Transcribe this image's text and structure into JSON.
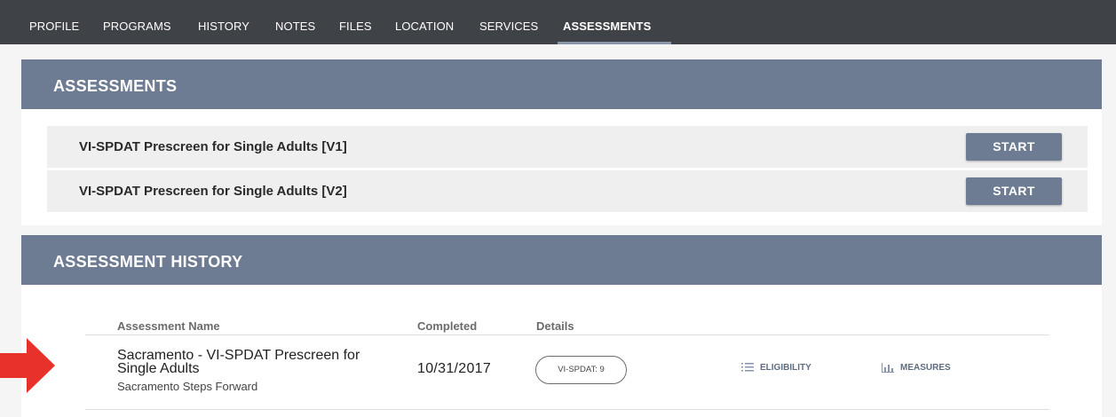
{
  "nav": {
    "tabs": [
      {
        "label": "PROFILE"
      },
      {
        "label": "PROGRAMS"
      },
      {
        "label": "HISTORY"
      },
      {
        "label": "NOTES"
      },
      {
        "label": "FILES"
      },
      {
        "label": "LOCATION"
      },
      {
        "label": "SERVICES"
      },
      {
        "label": "ASSESSMENTS",
        "active": true
      }
    ]
  },
  "assessments": {
    "title": "ASSESSMENTS",
    "items": [
      {
        "name": "VI-SPDAT Prescreen for Single Adults [V1]",
        "button": "START"
      },
      {
        "name": "VI-SPDAT Prescreen for Single Adults [V2]",
        "button": "START"
      }
    ]
  },
  "history": {
    "title": "ASSESSMENT HISTORY",
    "columns": [
      "Assessment Name",
      "Completed",
      "Details"
    ],
    "rows": [
      {
        "name": "Sacramento - VI-SPDAT Prescreen for Single Adults",
        "organization": "Sacramento Steps Forward",
        "completed": "10/31/2017",
        "score": "VI-SPDAT: 9",
        "eligibility": "ELIGIBILITY",
        "measures": "MEASURES"
      }
    ]
  },
  "colors": {
    "nav_bg": "#3f4247",
    "header_bg": "#6d7c93",
    "accent": "#8894a8",
    "arrow": "#e8312a"
  },
  "icons": {
    "callout": "red-arrow-icon",
    "eligibility": "list-icon",
    "measures": "bar-chart-icon"
  }
}
